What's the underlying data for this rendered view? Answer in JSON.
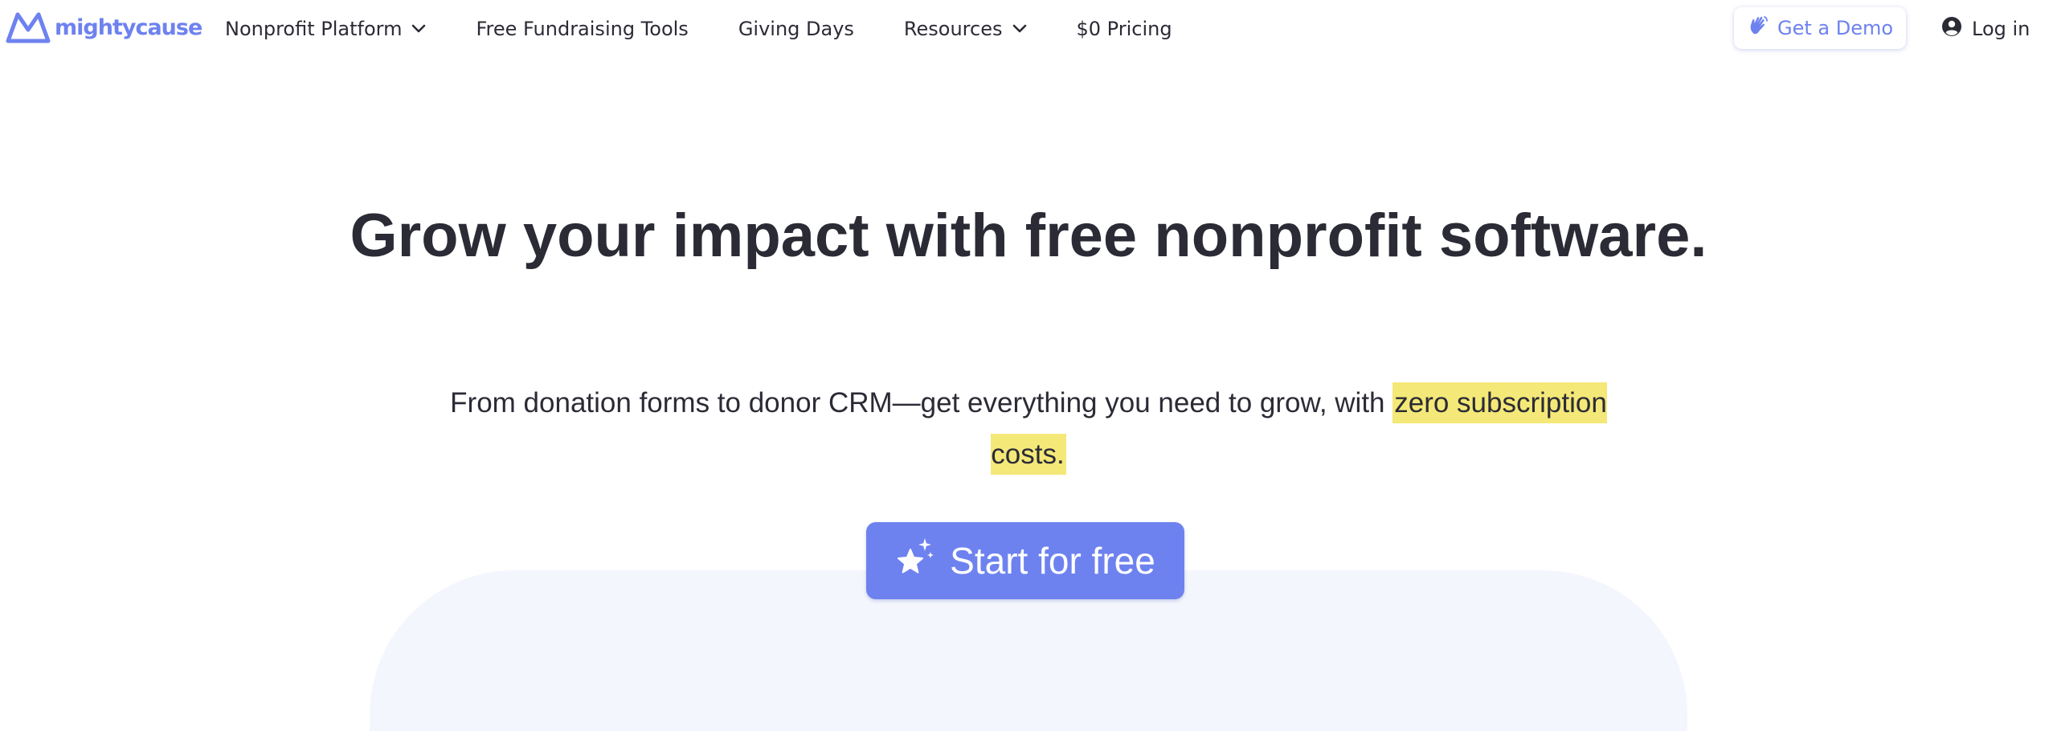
{
  "brand": {
    "name": "mightycause",
    "logo_icon": "mountain-m-icon",
    "accent_color": "#6e82ef",
    "highlight_color": "#f4e878",
    "text_color": "#2b2b36"
  },
  "nav": {
    "items": [
      {
        "label": "Nonprofit Platform",
        "has_dropdown": true,
        "icon": "chevron-down-icon"
      },
      {
        "label": "Free Fundraising Tools",
        "has_dropdown": false
      },
      {
        "label": "Giving Days",
        "has_dropdown": false
      },
      {
        "label": "Resources",
        "has_dropdown": true,
        "icon": "chevron-down-icon"
      },
      {
        "label": "$0 Pricing",
        "has_dropdown": false
      }
    ],
    "demo_label": "Get a Demo",
    "demo_icon": "waving-hand-icon",
    "login_label": "Log in",
    "login_icon": "user-circle-icon"
  },
  "hero": {
    "title": "Grow your impact with free nonprofit software.",
    "subtitle_text": "From donation forms to donor CRM—get everything you need to grow, with",
    "subtitle_highlight": "zero subscription costs.",
    "cta_label": "Start for free",
    "cta_icon": "sparkle-star-icon"
  }
}
